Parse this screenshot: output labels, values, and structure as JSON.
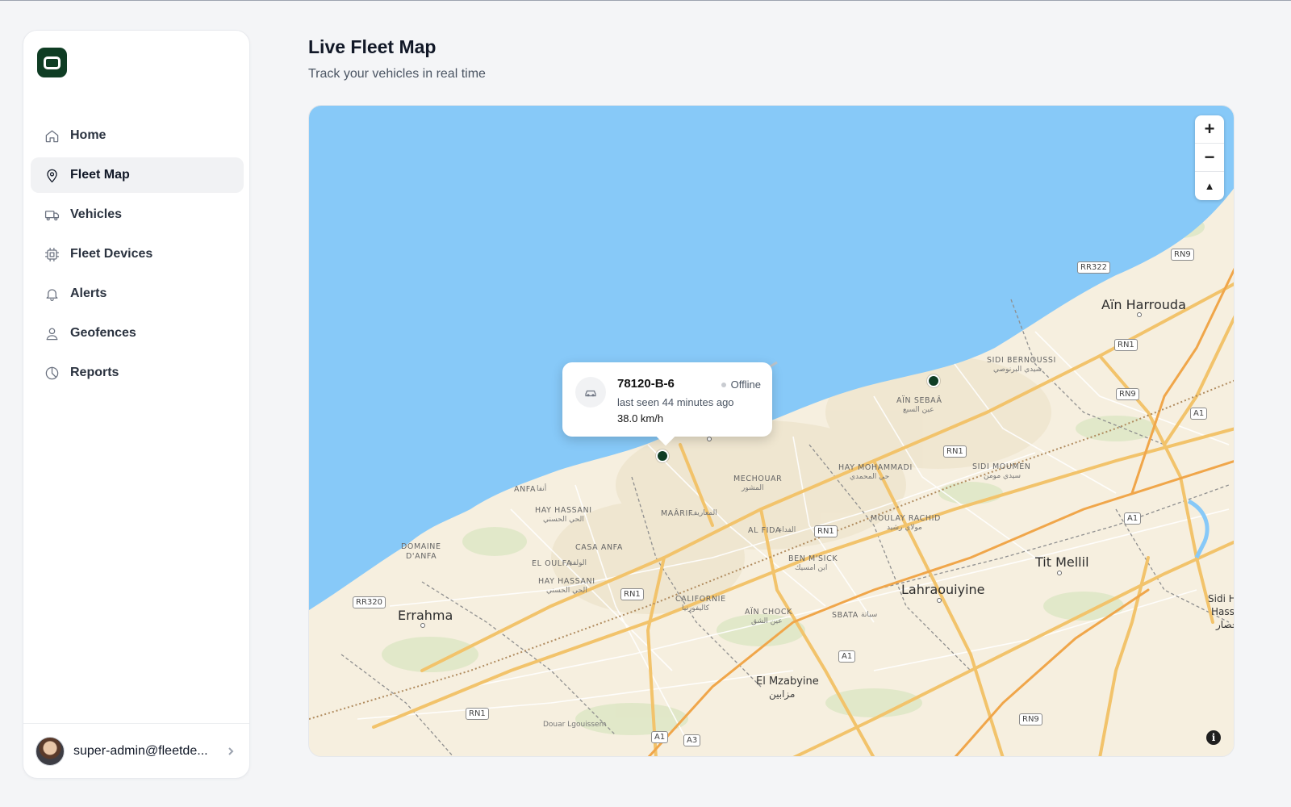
{
  "sidebar": {
    "items": [
      {
        "label": "Home",
        "icon": "home-icon"
      },
      {
        "label": "Fleet Map",
        "icon": "map-pin-icon",
        "active": true
      },
      {
        "label": "Vehicles",
        "icon": "truck-icon"
      },
      {
        "label": "Fleet Devices",
        "icon": "chip-icon"
      },
      {
        "label": "Alerts",
        "icon": "bell-icon"
      },
      {
        "label": "Geofences",
        "icon": "user-location-icon"
      },
      {
        "label": "Reports",
        "icon": "pie-chart-icon"
      }
    ],
    "user": {
      "email": "super-admin@fleetde..."
    }
  },
  "header": {
    "title": "Live Fleet Map",
    "subtitle": "Track your vehicles in real time"
  },
  "map": {
    "controls": {
      "zoom_in": "+",
      "zoom_out": "−",
      "compass": "▲"
    },
    "info": "i",
    "popup": {
      "plate": "78120-B-6",
      "status": "Offline",
      "last_seen": "last seen 44 minutes ago",
      "speed": "38.0 km/h"
    },
    "labels": {
      "ain_harrouda": "Aïn Harrouda",
      "sidi_bernoussi": "SIDI BERNOUSSI",
      "sidi_bernoussi_ar": "سيدي البرنوصي",
      "ain_sebaa": "AÏN SEBAÂ",
      "ain_sebaa_ar": "عين السبع",
      "sidi_moumen": "SIDI MOUMEN",
      "sidi_moumen_ar": "سيدي مومن",
      "hay_mohammadi": "HAY MOHAMMADI",
      "hay_mohammadi_ar": "حي المحمدي",
      "mechouar": "MECHOUAR",
      "mechouar_ar": "المشور",
      "anfa": "ANFA",
      "anfa_ar": "أنفا",
      "hay_hassani_1": "HAY HASSANI",
      "hay_hassani_1_ar": "الحي الحسني",
      "maarif": "MAÂRIF",
      "maarif_ar": "المعاريف",
      "al_fida": "AL FIDA",
      "al_fida_ar": "الفداء",
      "moulay_rachid": "MOULAY RACHID",
      "moulay_rachid_ar": "مولاي رشيد",
      "domaine_anfa_1": "DOMAINE",
      "domaine_anfa_2": "D'ANFA",
      "casa_anfa": "CASA ANFA",
      "el_oulfa": "EL OULFA",
      "el_oulfa_ar": "الولفة",
      "hay_hassani_2": "HAY HASSANI",
      "hay_hassani_2_ar": "الحي الحسني",
      "ben_msick": "BEN M'SICK",
      "ben_msick_ar": "ابن امسيك",
      "californie": "CALIFORNIE",
      "californie_ar": "كاليفورنيا",
      "ain_chock": "AÏN CHOCK",
      "ain_chock_ar": "عين الشق",
      "sbata": "SBATA",
      "sbata_ar": "سباتة",
      "tit_mellil": "Tit Mellil",
      "lahraouiyine": "Lahraouiyine",
      "errahma": "Errahma",
      "el_mzabyine": "El Mzabyine",
      "el_mzabyine_ar": "مزابين",
      "douar_lgouissem": "Douar Lgouissem",
      "sidi_hass_1": "Sidi H",
      "sidi_hass_2": "Hass",
      "sidi_hass_3": "حصار"
    },
    "shields": {
      "rr322": "RR322",
      "rn9_top": "RN9",
      "rn1_a": "RN1",
      "rn9_mid": "RN9",
      "a1_right": "A1",
      "rn1_b": "RN1",
      "rn1_c": "RN1",
      "a1_mid": "A1",
      "rr320": "RR320",
      "rn1_d": "RN1",
      "a1_bottom": "A1",
      "rn1_e": "RN1",
      "a1_b": "A1",
      "a3": "A3",
      "rn9_bottom": "RN9"
    }
  }
}
